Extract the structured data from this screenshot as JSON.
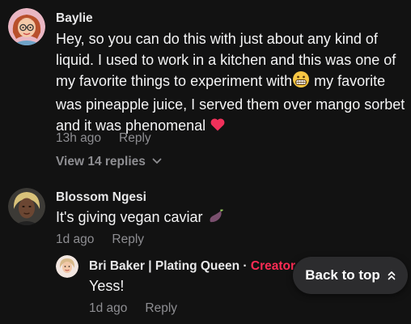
{
  "comments": [
    {
      "author": "Baylie",
      "avatar_icon": "avatar-redhead-glasses",
      "text_parts": [
        "Hey, so you can do this with just about any kind of liquid. I used to work in a kitchen and this was one of my favorite things to experiment with",
        " my favorite was pineapple juice, I served them over mango sorbet and it was phenomenal "
      ],
      "emoji_icons": [
        "grinning-teeth-emoji-icon",
        "red-heart-emoji-icon"
      ],
      "time": "13h ago",
      "reply_label": "Reply",
      "view_replies_label": "View 14 replies"
    },
    {
      "author": "Blossom Ngesi",
      "avatar_icon": "avatar-blonde-woman",
      "text": "It's giving vegan caviar ",
      "emoji_icon": "eggplant-emoji-icon",
      "time": "1d ago",
      "reply_label": "Reply",
      "replies": [
        {
          "author": "Bri Baker | Plating Queen",
          "separator": " · ",
          "badge": "Creator",
          "avatar_icon": "avatar-bri-baker",
          "text": "Yess!",
          "time": "1d ago",
          "reply_label": "Reply"
        }
      ]
    }
  ],
  "back_to_top": {
    "label": "Back to top",
    "icon": "double-chevron-up-icon"
  },
  "colors": {
    "background": "#121212",
    "creator_badge": "#fe2c55",
    "muted": "#8e8e92",
    "button_bg": "#2c2c2e"
  }
}
